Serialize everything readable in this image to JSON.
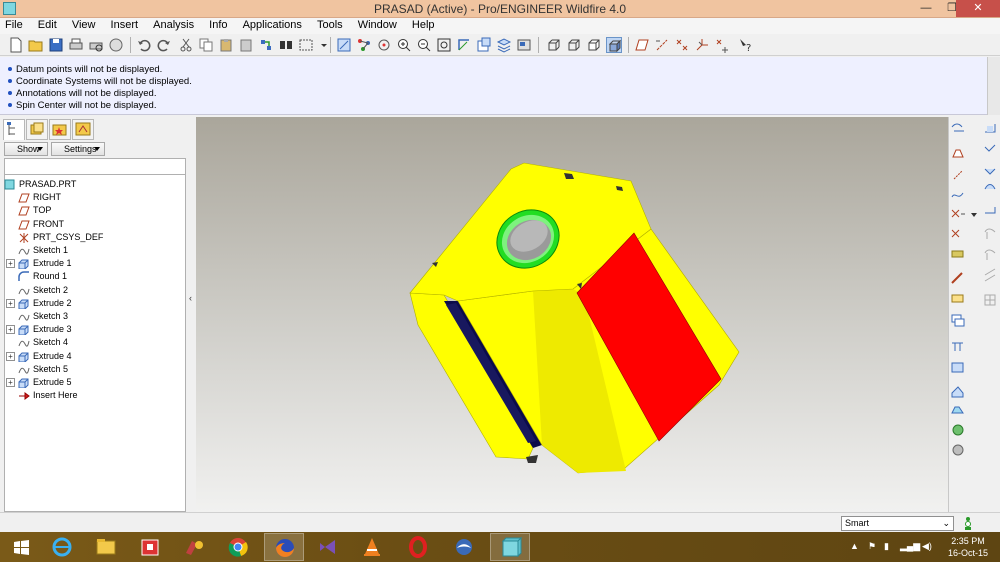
{
  "window": {
    "title": "PRASAD (Active) - Pro/ENGINEER Wildfire 4.0",
    "minimize": "—",
    "maximize": "❐",
    "close": "✕"
  },
  "menu": [
    "File",
    "Edit",
    "View",
    "Insert",
    "Analysis",
    "Info",
    "Applications",
    "Tools",
    "Window",
    "Help"
  ],
  "messages": [
    "Datum points will not be displayed.",
    "Coordinate Systems will not be displayed.",
    "Annotations will not be displayed.",
    "Spin Center will not be displayed."
  ],
  "navigator": {
    "show_label": "Show",
    "settings_label": "Settings",
    "tree": [
      {
        "label": "PRASAD.PRT",
        "icon": "part-icon",
        "expandable": false,
        "root": true
      },
      {
        "label": "RIGHT",
        "icon": "datum-plane-icon",
        "expandable": false
      },
      {
        "label": "TOP",
        "icon": "datum-plane-icon",
        "expandable": false
      },
      {
        "label": "FRONT",
        "icon": "datum-plane-icon",
        "expandable": false
      },
      {
        "label": "PRT_CSYS_DEF",
        "icon": "csys-icon",
        "expandable": false
      },
      {
        "label": "Sketch 1",
        "icon": "sketch-icon",
        "expandable": false
      },
      {
        "label": "Extrude 1",
        "icon": "extrude-icon",
        "expandable": true
      },
      {
        "label": "Round 1",
        "icon": "round-icon",
        "expandable": false
      },
      {
        "label": "Sketch 2",
        "icon": "sketch-icon",
        "expandable": false
      },
      {
        "label": "Extrude 2",
        "icon": "extrude-icon",
        "expandable": true
      },
      {
        "label": "Sketch 3",
        "icon": "sketch-icon",
        "expandable": false
      },
      {
        "label": "Extrude 3",
        "icon": "extrude-icon",
        "expandable": true
      },
      {
        "label": "Sketch 4",
        "icon": "sketch-icon",
        "expandable": false
      },
      {
        "label": "Extrude 4",
        "icon": "extrude-icon",
        "expandable": true
      },
      {
        "label": "Sketch 5",
        "icon": "sketch-icon",
        "expandable": false
      },
      {
        "label": "Extrude 5",
        "icon": "extrude-icon",
        "expandable": true
      },
      {
        "label": "Insert Here",
        "icon": "insert-arrow-icon",
        "expandable": false
      }
    ]
  },
  "model_colors": {
    "body": "#ffff00",
    "side_face": "#ff0000",
    "slot": "#0b0b4a",
    "ring": "#22dd22",
    "hole": "#9a9a9a"
  },
  "status": {
    "filter": "Smart"
  },
  "taskbar": {
    "apps": [
      "start-icon",
      "ie-icon",
      "explorer-icon",
      "store-icon",
      "paint-icon",
      "chrome-icon",
      "firefox-icon",
      "visual-studio-icon",
      "vlc-icon",
      "opera-icon",
      "thunderbird-icon",
      "proe-icon"
    ],
    "time": "2:35 PM",
    "date": "16-Oct-15"
  }
}
